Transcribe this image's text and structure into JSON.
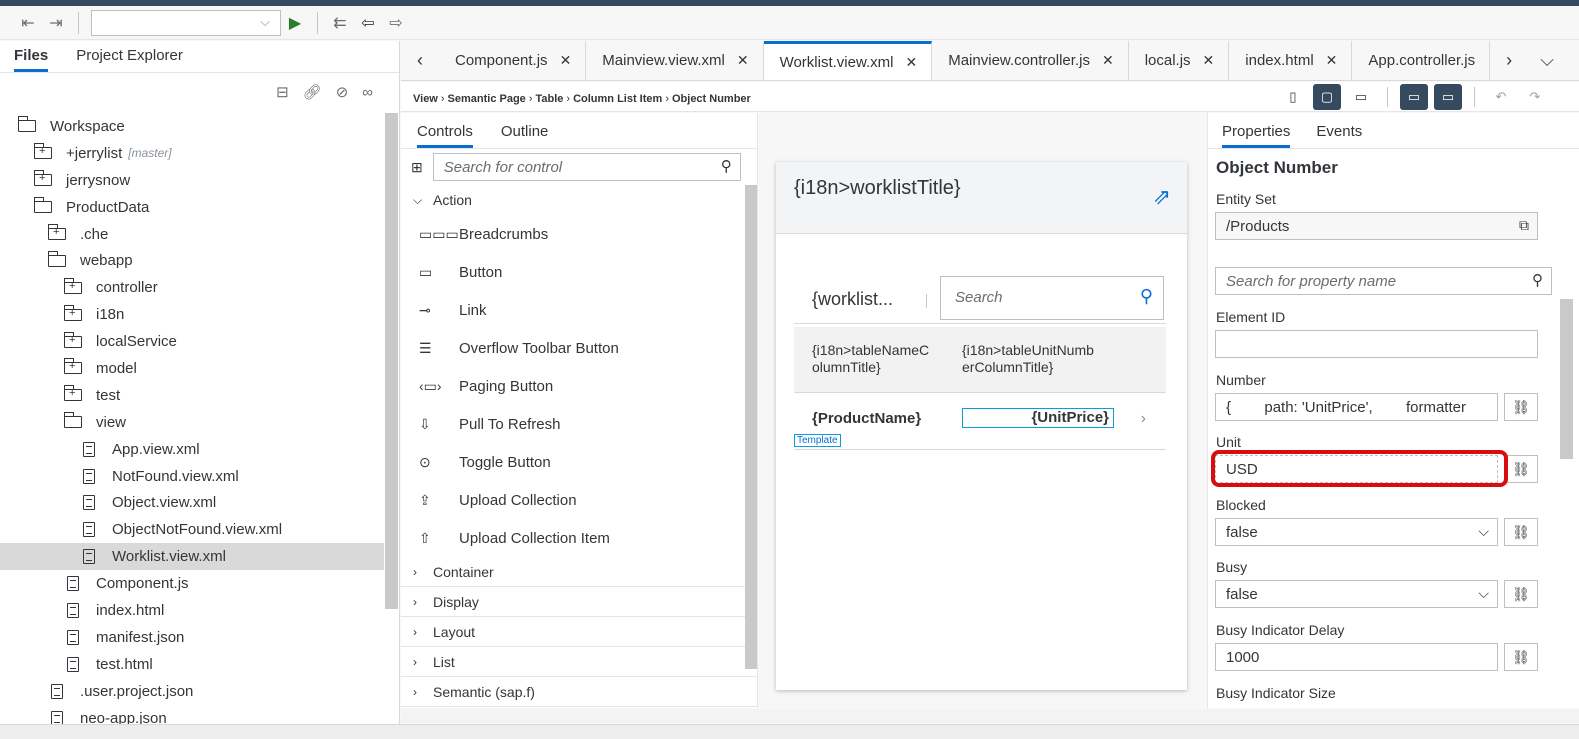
{
  "left_panel": {
    "tabs": [
      "Files",
      "Project Explorer"
    ],
    "tree": [
      {
        "label": "Workspace",
        "indent": 0,
        "type": "folder-open"
      },
      {
        "label": "+jerrylist",
        "tag": "[master]",
        "indent": 1,
        "type": "folder-plus"
      },
      {
        "label": "jerrysnow",
        "indent": 1,
        "type": "folder-plus"
      },
      {
        "label": "ProductData",
        "indent": 1,
        "type": "folder-open"
      },
      {
        "label": ".che",
        "indent": 2,
        "type": "folder-plus"
      },
      {
        "label": "webapp",
        "indent": 2,
        "type": "folder-open"
      },
      {
        "label": "controller",
        "indent": 3,
        "type": "folder-plus"
      },
      {
        "label": "i18n",
        "indent": 3,
        "type": "folder-plus"
      },
      {
        "label": "localService",
        "indent": 3,
        "type": "folder-plus"
      },
      {
        "label": "model",
        "indent": 3,
        "type": "folder-plus"
      },
      {
        "label": "test",
        "indent": 3,
        "type": "folder-plus"
      },
      {
        "label": "view",
        "indent": 3,
        "type": "folder-open"
      },
      {
        "label": "App.view.xml",
        "indent": 4,
        "type": "file"
      },
      {
        "label": "NotFound.view.xml",
        "indent": 4,
        "type": "file"
      },
      {
        "label": "Object.view.xml",
        "indent": 4,
        "type": "file"
      },
      {
        "label": "ObjectNotFound.view.xml",
        "indent": 4,
        "type": "file"
      },
      {
        "label": "Worklist.view.xml",
        "indent": 4,
        "type": "file",
        "selected": true
      },
      {
        "label": "Component.js",
        "indent": 3,
        "type": "file"
      },
      {
        "label": "index.html",
        "indent": 3,
        "type": "file"
      },
      {
        "label": "manifest.json",
        "indent": 3,
        "type": "file"
      },
      {
        "label": "test.html",
        "indent": 3,
        "type": "file"
      },
      {
        "label": ".user.project.json",
        "indent": 2,
        "type": "file"
      },
      {
        "label": "neo-app.json",
        "indent": 2,
        "type": "file"
      }
    ]
  },
  "editor_tabs": [
    {
      "label": "Component.js",
      "active": false
    },
    {
      "label": "Mainview.view.xml",
      "active": false
    },
    {
      "label": "Worklist.view.xml",
      "active": true
    },
    {
      "label": "Mainview.controller.js",
      "active": false
    },
    {
      "label": "local.js",
      "active": false
    },
    {
      "label": "index.html",
      "active": false
    },
    {
      "label": "App.controller.js",
      "active": false,
      "no_close": true
    }
  ],
  "breadcrumb": [
    "View",
    "Semantic Page",
    "Table",
    "Column List Item",
    "Object Number"
  ],
  "controls_panel": {
    "tabs": [
      "Controls",
      "Outline"
    ],
    "search_placeholder": "Search for control",
    "action_group": "Action",
    "action_items": [
      {
        "label": "Breadcrumbs",
        "icon": "▭▭▭"
      },
      {
        "label": "Button",
        "icon": "▭"
      },
      {
        "label": "Link",
        "icon": "⊸"
      },
      {
        "label": "Overflow Toolbar Button",
        "icon": "☰"
      },
      {
        "label": "Paging Button",
        "icon": "‹▭›"
      },
      {
        "label": "Pull To Refresh",
        "icon": "⇩"
      },
      {
        "label": "Toggle Button",
        "icon": "⊙"
      },
      {
        "label": "Upload Collection",
        "icon": "⇪"
      },
      {
        "label": "Upload Collection Item",
        "icon": "⇧"
      }
    ],
    "groups": [
      "Container",
      "Display",
      "Layout",
      "List",
      "Semantic (sap.f)"
    ]
  },
  "canvas": {
    "page_title": "{i18n>worklistTitle}",
    "toolbar_title": "{worklist...",
    "search_placeholder": "Search",
    "col1": "{i18n>tableNameColumnTitle}",
    "col1_display": "{i18n>tableNameC olumnTitle}",
    "col2_display": "{i18n>tableUnitNumb erColumnTitle}",
    "row_name": "{ProductName}",
    "row_price": "{UnitPrice}",
    "template_label": "Template"
  },
  "properties": {
    "tabs": [
      "Properties",
      "Events"
    ],
    "title": "Object Number",
    "entity_set_label": "Entity Set",
    "entity_set_value": "/Products",
    "search_placeholder": "Search for property name",
    "element_id_label": "Element ID",
    "element_id_value": "",
    "number_label": "Number",
    "number_value": "{        path: 'UnitPrice',        formatter",
    "unit_label": "Unit",
    "unit_value": "USD",
    "blocked_label": "Blocked",
    "blocked_value": "false",
    "busy_label": "Busy",
    "busy_value": "false",
    "busy_delay_label": "Busy Indicator Delay",
    "busy_delay_value": "1000",
    "busy_size_label": "Busy Indicator Size"
  },
  "colors": {
    "accent": "#0a6ed1",
    "shell": "#354a5f",
    "highlight": "#d80d0d"
  }
}
